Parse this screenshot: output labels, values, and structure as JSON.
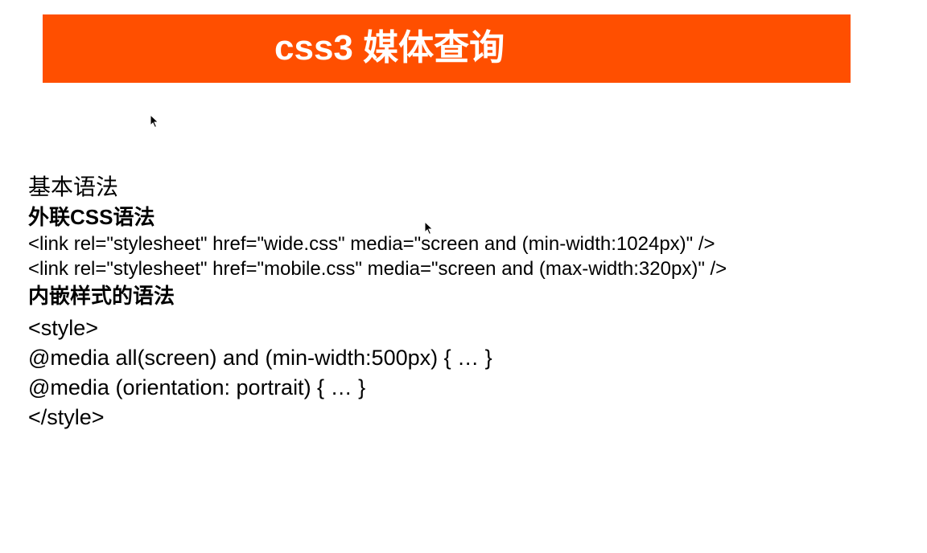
{
  "title_banner": {
    "text": "css3 媒体查询",
    "background_color": "#ff4f00"
  },
  "cursors": [
    {
      "icon": "mouse-pointer-icon"
    },
    {
      "icon": "mouse-pointer-icon"
    }
  ],
  "content": {
    "basic_syntax_label": "基本语法",
    "external_css_heading": "外联CSS语法",
    "external_css_lines": [
      "<link rel=\"stylesheet\" href=\"wide.css\" media=\"screen and (min-width:1024px)\" />",
      "<link rel=\"stylesheet\" href=\"mobile.css\" media=\"screen and (max-width:320px)\" />"
    ],
    "embedded_style_heading": "内嵌样式的语法",
    "embedded_style_lines": [
      "<style>",
      "@media all(screen) and (min-width:500px) { … }",
      "@media (orientation: portrait) { … }",
      "</style>"
    ]
  }
}
